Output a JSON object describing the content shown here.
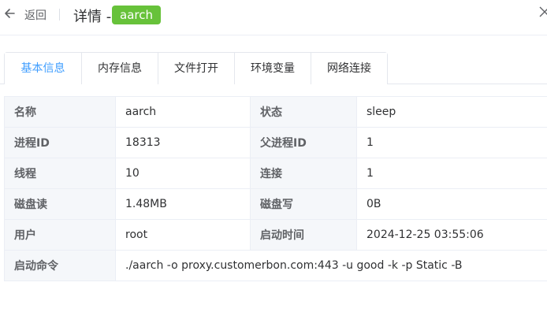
{
  "header": {
    "back_label": "返回",
    "title": "详情 -",
    "process_name": "aarch"
  },
  "tabs": [
    {
      "label": "基本信息",
      "active": true
    },
    {
      "label": "内存信息",
      "active": false
    },
    {
      "label": "文件打开",
      "active": false
    },
    {
      "label": "环境变量",
      "active": false
    },
    {
      "label": "网络连接",
      "active": false
    }
  ],
  "info": {
    "name_label": "名称",
    "name_value": "aarch",
    "status_label": "状态",
    "status_value": "sleep",
    "pid_label": "进程ID",
    "pid_value": "18313",
    "ppid_label": "父进程ID",
    "ppid_value": "1",
    "threads_label": "线程",
    "threads_value": "10",
    "connections_label": "连接",
    "connections_value": "1",
    "disk_read_label": "磁盘读",
    "disk_read_value": "1.48MB",
    "disk_write_label": "磁盘写",
    "disk_write_value": "0B",
    "user_label": "用户",
    "user_value": "root",
    "start_time_label": "启动时间",
    "start_time_value": "2024-12-25 03:55:06",
    "command_label": "启动命令",
    "command_value": "./aarch -o proxy.customerbon.com:443 -u good -k -p Static -B"
  },
  "colors": {
    "accent": "#409eff",
    "tag_green": "#67c23a",
    "label_bg": "#f5f7fa",
    "border": "#ebeef5"
  }
}
